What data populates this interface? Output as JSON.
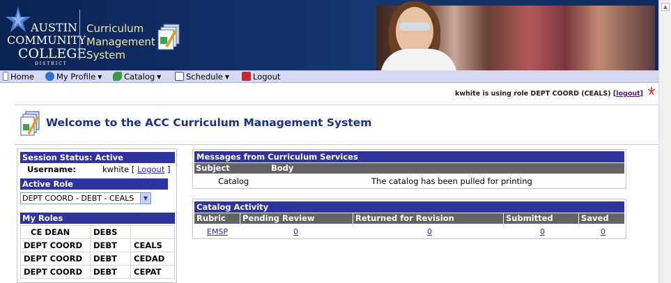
{
  "header": {
    "logo": {
      "line1": "AUSTIN",
      "line2": "COMMUNITY",
      "line3": "COLLEGE",
      "line4": "DISTRICT"
    },
    "system_title": [
      "Curriculum",
      "Management",
      "System"
    ]
  },
  "menu": {
    "items": [
      {
        "label": "Home",
        "icon": "home-icon"
      },
      {
        "label": "My Profile",
        "icon": "info-icon",
        "caret": "▼"
      },
      {
        "label": "Catalog",
        "icon": "catalog-icon",
        "caret": "▼"
      },
      {
        "label": "Schedule",
        "icon": "schedule-icon",
        "caret": "▼"
      },
      {
        "label": "Logout",
        "icon": "logout-icon"
      }
    ]
  },
  "role_line": {
    "text": "kwhite is using role DEPT COORD (CEALS) [",
    "logout": "logout",
    "close": "]"
  },
  "welcome": {
    "title": "Welcome to the ACC Curriculum Management System"
  },
  "session": {
    "title": "Session Status: Active",
    "username_label": "Username:",
    "username_value": "kwhite",
    "bracket_open": "[",
    "logout": "Logout",
    "bracket_close": "]"
  },
  "active_role": {
    "title": "Active Role",
    "selected": "DEPT COORD - DEBT - CEALS"
  },
  "my_roles": {
    "title": "My Roles",
    "rows": [
      [
        "CE DEAN",
        "DEBS",
        ""
      ],
      [
        "DEPT COORD",
        "DEBT",
        "CEALS"
      ],
      [
        "DEPT COORD",
        "DEBT",
        "CEDAD"
      ],
      [
        "DEPT COORD",
        "DEBT",
        "CEPAT"
      ]
    ]
  },
  "messages": {
    "title": "Messages from Curriculum Services",
    "headers": [
      "Subject",
      "Body"
    ],
    "rows": [
      {
        "subject": "Catalog",
        "body": "The catalog has been pulled for printing"
      }
    ]
  },
  "catalog_activity": {
    "title": "Catalog Activity",
    "headers": [
      "Rubric",
      "Pending Review",
      "Returned for Revision",
      "Submitted",
      "Saved"
    ],
    "rows": [
      {
        "rubric": "EMSP",
        "pending": "0",
        "returned": "0",
        "submitted": "0",
        "saved": "0"
      }
    ]
  },
  "colors": {
    "banner": "#0d2a5c",
    "menu_bg": "#d7d9f2",
    "section_bar": "#2e33a0",
    "table_header": "#636363",
    "welcome_title": "#1c2f8a",
    "link": "#2a2ad0"
  }
}
